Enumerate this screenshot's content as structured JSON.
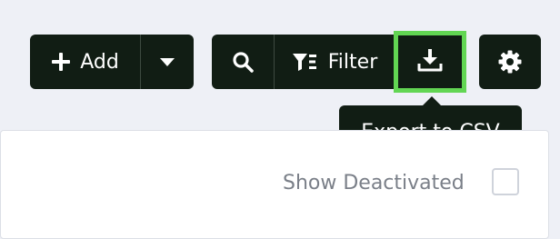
{
  "toolbar": {
    "add_label": "Add",
    "filter_label": "Filter"
  },
  "tooltip": {
    "export_label": "Export to CSV"
  },
  "options": {
    "show_deactivated_label": "Show Deactivated",
    "show_deactivated_checked": false
  },
  "colors": {
    "button_bg": "#111d14",
    "button_text": "#ffffff",
    "focus_ring": "#62d653",
    "page_bg": "#eef0f6",
    "muted_text": "#7a7f88"
  },
  "icons": {
    "add": "plus-icon",
    "add_menu": "caret-down-icon",
    "search": "search-icon",
    "filter": "filter-icon",
    "export": "download-icon",
    "settings": "gear-icon"
  }
}
